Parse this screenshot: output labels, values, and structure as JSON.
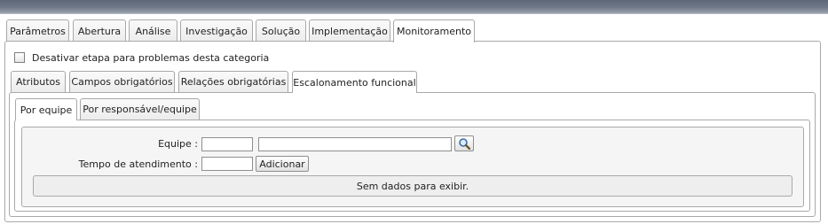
{
  "main_tabs": [
    "Parâmetros",
    "Abertura",
    "Análise",
    "Investigação",
    "Solução",
    "Implementação",
    "Monitoramento"
  ],
  "disable_stage_label": "Desativar etapa para problemas desta categoria",
  "sub_tabs": [
    "Atributos",
    "Campos obrigatórios",
    "Relações obrigatórias",
    "Escalonamento funcional"
  ],
  "inner_tabs": [
    "Por equipe",
    "Por responsável/equipe"
  ],
  "form": {
    "team_label": "Equipe :",
    "team_code_value": "",
    "team_name_value": "",
    "time_label": "Tempo de atendimento :",
    "time_value": "",
    "add_button": "Adicionar"
  },
  "empty_message": "Sem dados para exibir.",
  "icons": {
    "search": "magnifier-icon"
  },
  "colors": {
    "topbar": "#6f7888",
    "border": "#a9a9a9",
    "panel_bg": "#f4f4f4"
  }
}
